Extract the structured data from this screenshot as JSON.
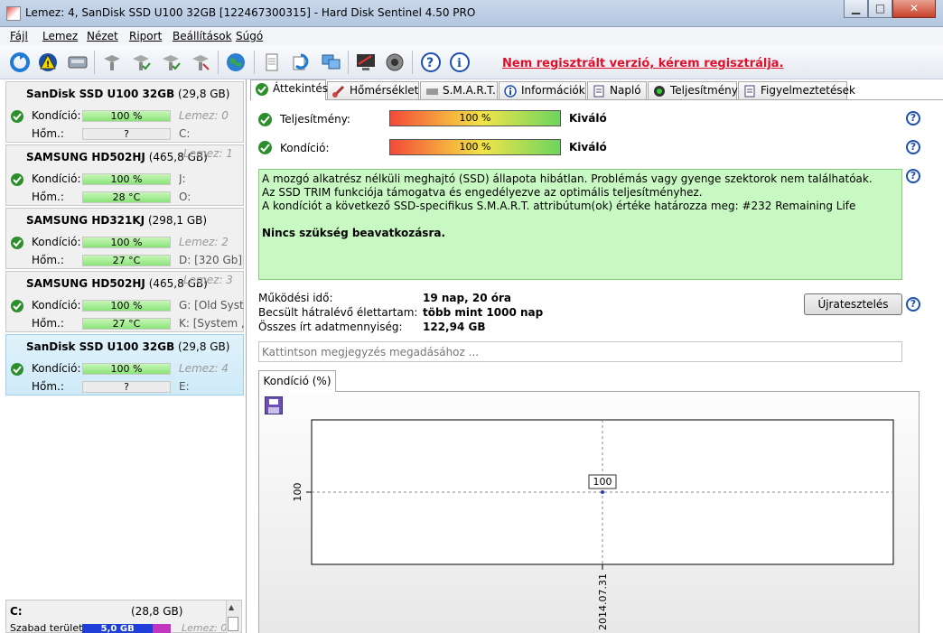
{
  "window": {
    "title": "Lemez: 4, SanDisk SSD U100 32GB [122467300315]  -  Hard Disk Sentinel 4.50 PRO",
    "minimize": "▁",
    "maximize": "□",
    "close": "✕"
  },
  "menu": [
    "Fájl",
    "Lemez",
    "Nézet",
    "Riport",
    "Beállítások",
    "Súgó"
  ],
  "toolbar": {
    "register_text": "Nem regisztrált verzió, kérem regisztrálja.",
    "icons": [
      "refresh-icon",
      "warning-icon",
      "drive-icon",
      "disk-gray-icon",
      "disk-check-icon",
      "disk-check2-icon",
      "disk-tools-icon",
      "globe-icon",
      "report-icon",
      "copy-icon",
      "network-icon",
      "monitor-icon",
      "speaker-icon",
      "help-icon",
      "info-icon"
    ]
  },
  "disks": [
    {
      "name": "SanDisk SSD U100 32GB",
      "size": "(29,8 GB)",
      "condition_label": "Kondíció:",
      "condition": "100 %",
      "condition_pct": 100,
      "side1": "Lemez: 0",
      "temp_label": "Hőm.:",
      "temp": "?",
      "side2": "C:"
    },
    {
      "name": "SAMSUNG HD502HJ",
      "size": "(465,8 GB)",
      "condition_label": "Kondíció:",
      "condition": "100 %",
      "condition_pct": 100,
      "side1": "Lemez: 1",
      "temp_label": "Hőm.:",
      "temp": "28 °C",
      "side2": "J:",
      "side3": "O:"
    },
    {
      "name": "SAMSUNG HD321KJ",
      "size": "(298,1 GB)",
      "condition_label": "Kondíció:",
      "condition": "100 %",
      "condition_pct": 100,
      "side1": "Lemez: 2",
      "temp_label": "Hőm.:",
      "temp": "27 °C",
      "side2": "D: [320 Gb]"
    },
    {
      "name": "SAMSUNG HD502HJ",
      "size": "(465,8 GB)",
      "condition_label": "Kondíció:",
      "condition": "100 %",
      "condition_pct": 100,
      "side1": "Lemez: 3",
      "temp_label": "Hőm.:",
      "temp": "27 °C",
      "side2": "G: [Old System]",
      "side3": "K: [System , P"
    },
    {
      "name": "SanDisk SSD U100 32GB",
      "size": "(29,8 GB)",
      "condition_label": "Kondíció:",
      "condition": "100 %",
      "condition_pct": 100,
      "side1": "Lemez: 4",
      "temp_label": "Hőm.:",
      "temp": "?",
      "side2": "E:"
    }
  ],
  "volume": {
    "drive": "C:",
    "size": "(28,8 GB)",
    "free_label": "Szabad terület",
    "free": "5,0 GB",
    "free_pct": 80,
    "side": "Lemez: 0"
  },
  "tabs": [
    "Áttekintés",
    "Hőmérséklet",
    "S.M.A.R.T.",
    "Információk",
    "Napló",
    "Teljesítmény",
    "Figyelmeztetések"
  ],
  "overview": {
    "performance_label": "Teljesítmény:",
    "performance_value": "100 %",
    "performance_pct": 100,
    "performance_eval": "Kiváló",
    "condition_label": "Kondíció:",
    "condition_value": "100 %",
    "condition_pct": 100,
    "condition_eval": "Kiváló",
    "status_lines": [
      "A mozgó alkatrész nélküli meghajtó (SSD) állapota hibátlan. Problémás vagy gyenge szektorok nem találhatóak.",
      "Az SSD TRIM funkciója támogatva és engedélyezve az optimális teljesítményhez.",
      "A kondíciót a következő SSD-specifikus S.M.A.R.T. attribútum(ok) értéke határozza meg:  #232 Remaining Life"
    ],
    "status_action": "Nincs szükség beavatkozásra.",
    "uptime_label": "Működési idő:",
    "uptime_value": "19 nap, 20 óra",
    "remaining_label": "Becsült hátralévő élettartam:",
    "remaining_value": "több mint 1000 nap",
    "written_label": "Összes írt adatmennyiség:",
    "written_value": "122,94 GB",
    "retest_button": "Újratesztelés",
    "note_placeholder": "Kattintson megjegyzés megadásához ..."
  },
  "chart_tab": "Kondíció  (%)",
  "chart_data": {
    "type": "line",
    "x": [
      "2014.07.31"
    ],
    "series": [
      {
        "values": [
          100
        ]
      }
    ],
    "ylabel": "",
    "xlabel": "",
    "y_tick_labels": [
      "100"
    ],
    "data_labels": [
      "100"
    ],
    "grid": true
  }
}
